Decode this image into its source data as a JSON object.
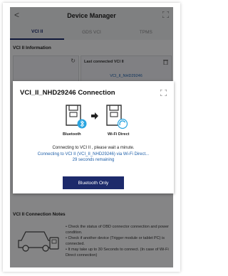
{
  "header": {
    "title": "Device Manager"
  },
  "tabs": [
    {
      "label": "VCI II"
    },
    {
      "label": "GDS VCI"
    },
    {
      "label": "TPMS"
    }
  ],
  "vci_info": {
    "section_title": "VCI II Information",
    "last_connected_label": "Last connected VCI II",
    "last_connected_value": "VCI_II_NHD29246"
  },
  "modal": {
    "title": "VCI_II_NHD29246 Connection",
    "bluetooth_label": "Bluetooth",
    "wifi_label": "Wi-Fi Direct",
    "line1": "Connecting to VCI II , please wait a minute.",
    "line2": "Connecting to VCI II (VCI_II_NHD29246) via Wi-Fi Direct...",
    "line3": "29 seconds remaining",
    "button": "Bluetooth Only"
  },
  "notes": {
    "section_title": "VCI II Connection Notes",
    "items": [
      "• Check the status of OBD connector connection and power condition.",
      "• Check if another device (Trigger module or tablet PC) is connected.",
      "• It may take up to 30 Seconds to connect. (In case of Wi-Fi Direct connection)"
    ]
  },
  "colors": {
    "accent": "#1d2a6b",
    "link": "#1d5ea8"
  }
}
